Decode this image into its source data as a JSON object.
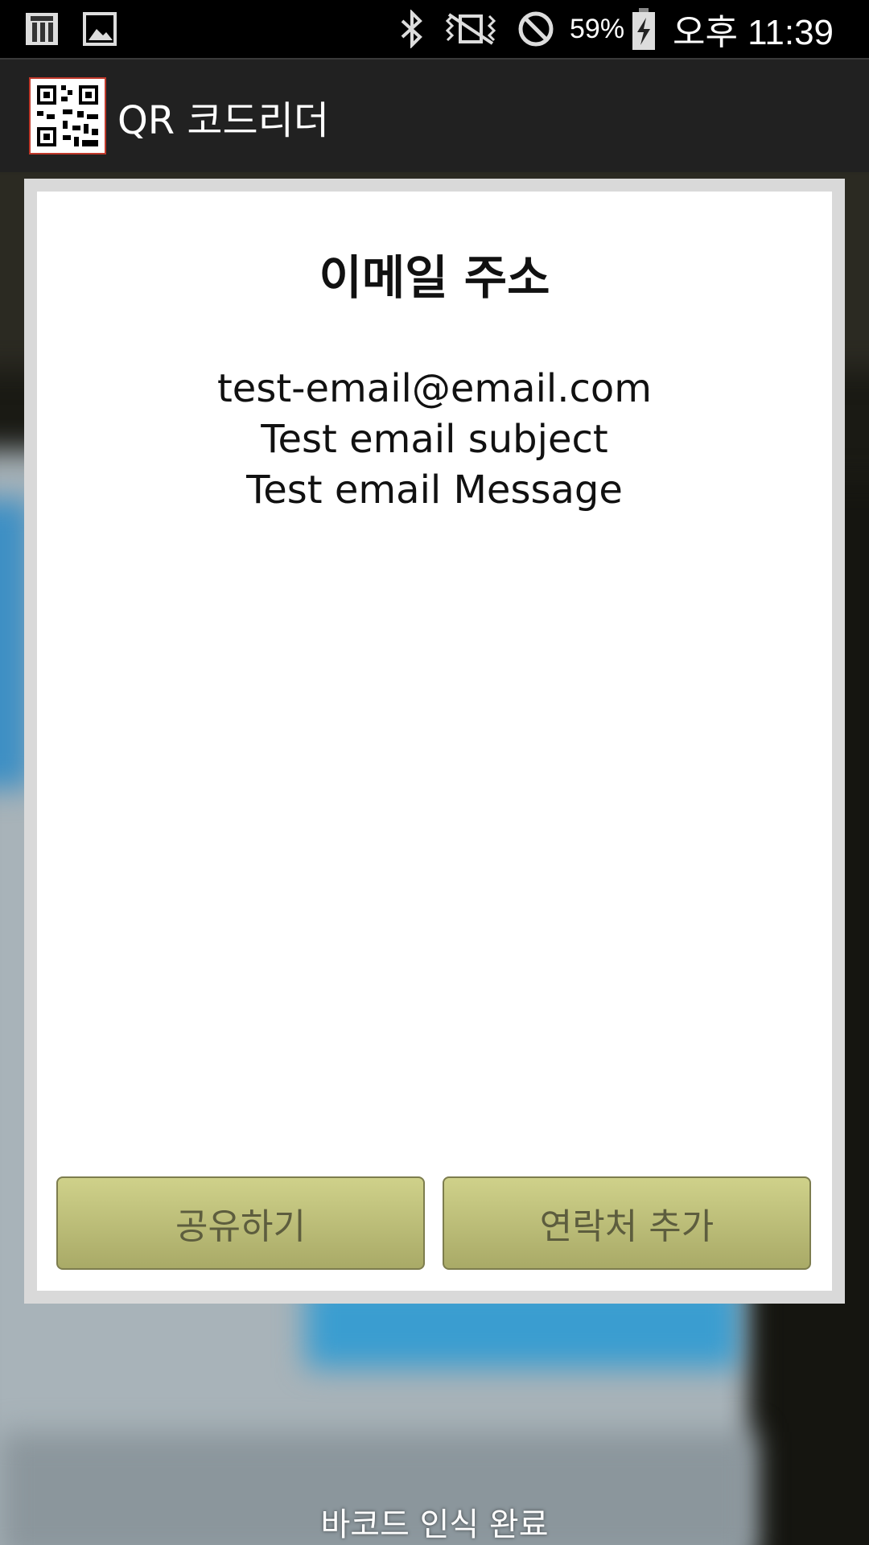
{
  "status_bar": {
    "battery_percent": "59%",
    "time": "오후 11:39",
    "icons": [
      "app-notification-icon",
      "gallery-icon",
      "bluetooth-icon",
      "vibrate-icon",
      "do-not-disturb-icon",
      "battery-charging-icon"
    ]
  },
  "action_bar": {
    "title": "QR 코드리더",
    "icon": "qr-code-icon"
  },
  "dialog": {
    "title": "이메일 주소",
    "lines": [
      "test-email@email.com",
      "Test email subject",
      "Test email Message"
    ],
    "buttons": {
      "share": "공유하기",
      "add_contact": "연락처 추가"
    }
  },
  "caption": "바코드 인식 완료",
  "colors": {
    "button_top": "#cfd18a",
    "button_bottom": "#a9aa67",
    "button_text": "#5d5d3e",
    "action_bar": "#212121"
  }
}
